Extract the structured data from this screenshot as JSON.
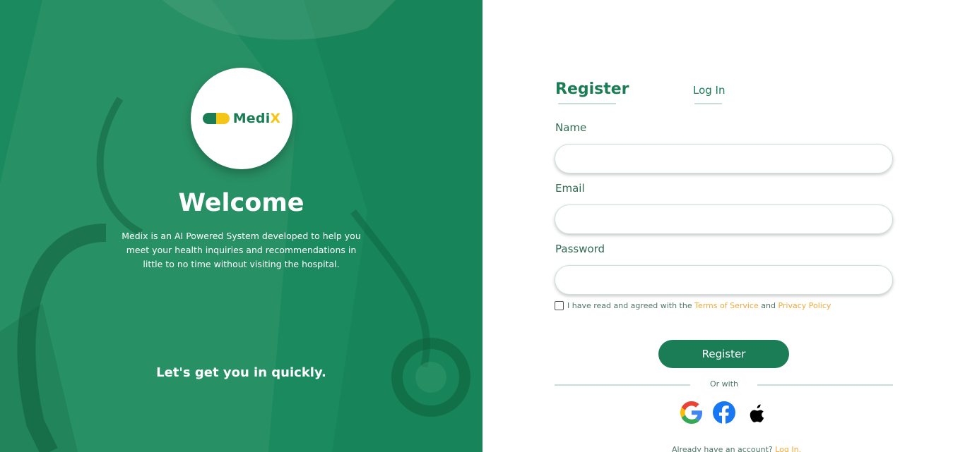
{
  "brand": {
    "name_main": "Medi",
    "name_accent": "X",
    "colors": {
      "green": "#1a7d56",
      "yellow": "#f5c518",
      "panel": "#1c8a5f",
      "link": "#f0a93a"
    }
  },
  "left_panel": {
    "welcome": "Welcome",
    "description": "Medix is an AI Powered System developed to help you meet your health inquiries and recommendations in little to no time without visiting the hospital.",
    "tagline": "Let's get you in quickly."
  },
  "tabs": {
    "register": "Register",
    "login": "Log In",
    "active": "register"
  },
  "form": {
    "name_label": "Name",
    "name_value": "",
    "email_label": "Email",
    "email_value": "",
    "password_label": "Password",
    "password_value": "",
    "agree_prefix": "I have read and agreed with the ",
    "terms_link": "Terms of Service",
    "agree_and": " and ",
    "privacy_link": "Privacy Policy",
    "agree_checked": false,
    "submit_label": "Register"
  },
  "social": {
    "or_with": "Or with",
    "providers": [
      "google-icon",
      "facebook-icon",
      "apple-icon"
    ]
  },
  "footer": {
    "prompt": "Already have an account? ",
    "login_link": "Log In."
  }
}
